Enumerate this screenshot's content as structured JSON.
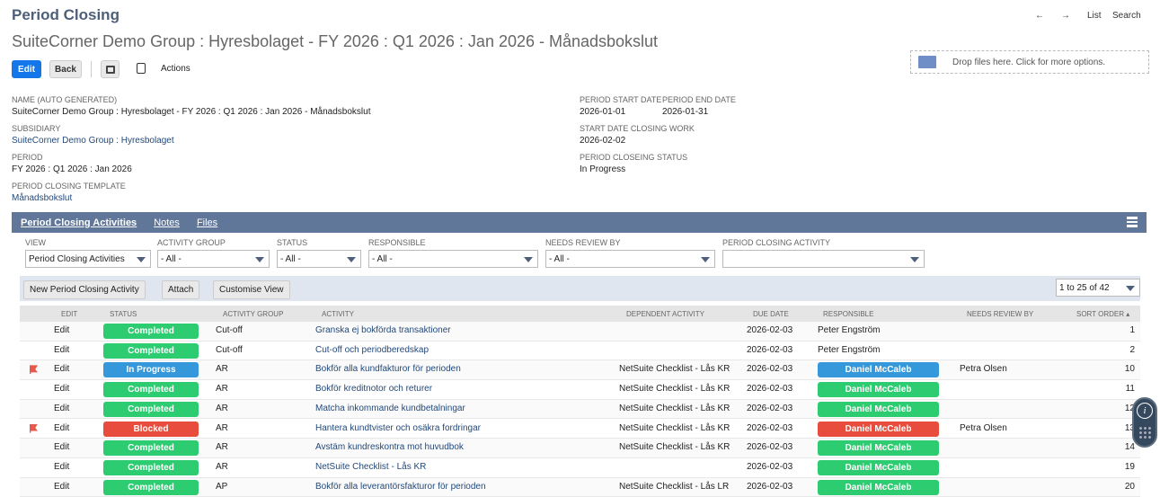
{
  "header": {
    "title": "Period Closing",
    "subtitle": "SuiteCorner Demo Group : Hyresbolaget - FY 2026 : Q1 2026 : Jan 2026 - Månadsbokslut",
    "nav": {
      "back": "←",
      "forward": "→",
      "list": "List",
      "search": "Search"
    }
  },
  "toolbar": {
    "edit": "Edit",
    "back": "Back",
    "actions": "Actions"
  },
  "dropzone": "Drop files here. Click for more options.",
  "fields": {
    "name_label": "NAME (AUTO GENERATED)",
    "name": "SuiteCorner Demo Group : Hyresbolaget - FY 2026 : Q1 2026 : Jan 2026 - Månadsbokslut",
    "subsidiary_label": "SUBSIDIARY",
    "subsidiary": "SuiteCorner Demo Group : Hyresbolaget",
    "period_label": "PERIOD",
    "period": "FY 2026 : Q1 2026 : Jan 2026",
    "template_label": "PERIOD CLOSING TEMPLATE",
    "template": "Månadsbokslut",
    "start_label": "PERIOD START DATE",
    "start": "2026-01-01",
    "end_label": "PERIOD END DATE",
    "end": "2026-01-31",
    "work_label": "START DATE CLOSING WORK",
    "work": "2026-02-02",
    "status_label": "PERIOD CLOSEING STATUS",
    "status": "In Progress"
  },
  "tabs": [
    "Period Closing Activities",
    "Notes",
    "Files"
  ],
  "filters": [
    {
      "label": "VIEW",
      "value": "Period Closing Activities"
    },
    {
      "label": "ACTIVITY GROUP",
      "value": "- All -"
    },
    {
      "label": "STATUS",
      "value": "- All -"
    },
    {
      "label": "RESPONSIBLE",
      "value": "- All -"
    },
    {
      "label": "NEEDS REVIEW BY",
      "value": "- All -"
    },
    {
      "label": "PERIOD CLOSING ACTIVITY",
      "value": ""
    }
  ],
  "list_buttons": {
    "new": "New Period Closing Activity",
    "attach": "Attach",
    "customise": "Customise View",
    "pager": "1 to 25 of 42"
  },
  "columns": [
    "EDIT",
    "STATUS",
    "ACTIVITY GROUP",
    "ACTIVITY",
    "DEPENDENT ACTIVITY",
    "DUE DATE",
    "RESPONSIBLE",
    "NEEDS REVIEW BY",
    "SORT ORDER ▴"
  ],
  "colors": {
    "completed": "#2ecc71",
    "in_progress": "#3498db",
    "blocked": "#e74c3c"
  },
  "rows": [
    {
      "flag": false,
      "edit": "Edit",
      "status": "Completed",
      "group": "Cut-off",
      "activity": "Granska ej bokförda transaktioner",
      "dependent": "",
      "due": "2026-02-03",
      "responsible": "Peter Engström",
      "resp_badge": "",
      "review": "",
      "sort": "1"
    },
    {
      "flag": false,
      "edit": "Edit",
      "status": "Completed",
      "group": "Cut-off",
      "activity": "Cut-off och periodberedskap",
      "dependent": "",
      "due": "2026-02-03",
      "responsible": "Peter Engström",
      "resp_badge": "",
      "review": "",
      "sort": "2"
    },
    {
      "flag": true,
      "edit": "Edit",
      "status": "In Progress",
      "group": "AR",
      "activity": "Bokför alla kundfakturor för perioden",
      "dependent": "NetSuite Checklist - Lås KR",
      "due": "2026-02-03",
      "responsible": "Daniel McCaleb",
      "resp_badge": "In Progress",
      "review": "Petra Olsen",
      "sort": "10"
    },
    {
      "flag": false,
      "edit": "Edit",
      "status": "Completed",
      "group": "AR",
      "activity": "Bokför kreditnotor och returer",
      "dependent": "NetSuite Checklist - Lås KR",
      "due": "2026-02-03",
      "responsible": "Daniel McCaleb",
      "resp_badge": "Completed",
      "review": "",
      "sort": "11"
    },
    {
      "flag": false,
      "edit": "Edit",
      "status": "Completed",
      "group": "AR",
      "activity": "Matcha inkommande kundbetalningar",
      "dependent": "NetSuite Checklist - Lås KR",
      "due": "2026-02-03",
      "responsible": "Daniel McCaleb",
      "resp_badge": "Completed",
      "review": "",
      "sort": "12"
    },
    {
      "flag": true,
      "edit": "Edit",
      "status": "Blocked",
      "group": "AR",
      "activity": "Hantera kundtvister och osäkra fordringar",
      "dependent": "NetSuite Checklist - Lås KR",
      "due": "2026-02-03",
      "responsible": "Daniel McCaleb",
      "resp_badge": "Blocked",
      "review": "Petra Olsen",
      "sort": "13"
    },
    {
      "flag": false,
      "edit": "Edit",
      "status": "Completed",
      "group": "AR",
      "activity": "Avstäm kundreskontra mot huvudbok",
      "dependent": "NetSuite Checklist - Lås KR",
      "due": "2026-02-03",
      "responsible": "Daniel McCaleb",
      "resp_badge": "Completed",
      "review": "",
      "sort": "14"
    },
    {
      "flag": false,
      "edit": "Edit",
      "status": "Completed",
      "group": "AR",
      "activity": "NetSuite Checklist - Lås KR",
      "dependent": "",
      "due": "2026-02-03",
      "responsible": "Daniel McCaleb",
      "resp_badge": "Completed",
      "review": "",
      "sort": "19"
    },
    {
      "flag": false,
      "edit": "Edit",
      "status": "Completed",
      "group": "AP",
      "activity": "Bokför alla leverantörsfakturor för perioden",
      "dependent": "NetSuite Checklist - Lås LR",
      "due": "2026-02-03",
      "responsible": "Daniel McCaleb",
      "resp_badge": "Completed",
      "review": "",
      "sort": "20"
    }
  ]
}
